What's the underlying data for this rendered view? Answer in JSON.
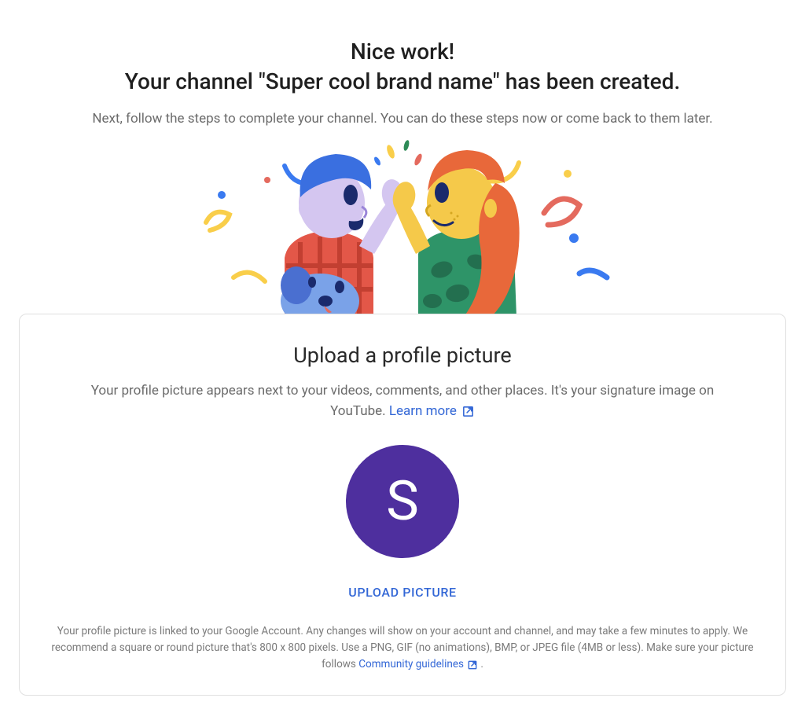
{
  "header": {
    "title_line1": "Nice work!",
    "title_line2": "Your channel \"Super cool brand name\" has been created.",
    "subtitle": "Next, follow the steps to complete your channel. You can do these steps now or come back to them later."
  },
  "card": {
    "title": "Upload a profile picture",
    "desc_part1": "Your profile picture appears next to your videos, comments, and other places. It's your signature image on YouTube. ",
    "learn_more_label": "Learn more",
    "avatar_initial": "S",
    "avatar_color": "#4e2f9e",
    "upload_button_label": "UPLOAD PICTURE",
    "fineprint_part1": "Your profile picture is linked to your Google Account. Any changes will show on your account and channel, and may take a few minutes to apply. We recommend a square or round picture that's 800 x 800 pixels. Use a PNG, GIF (no animations), BMP, or JPEG file (4MB or less). Make sure your picture follows ",
    "community_guidelines_label": "Community guidelines",
    "fineprint_period": " ."
  }
}
